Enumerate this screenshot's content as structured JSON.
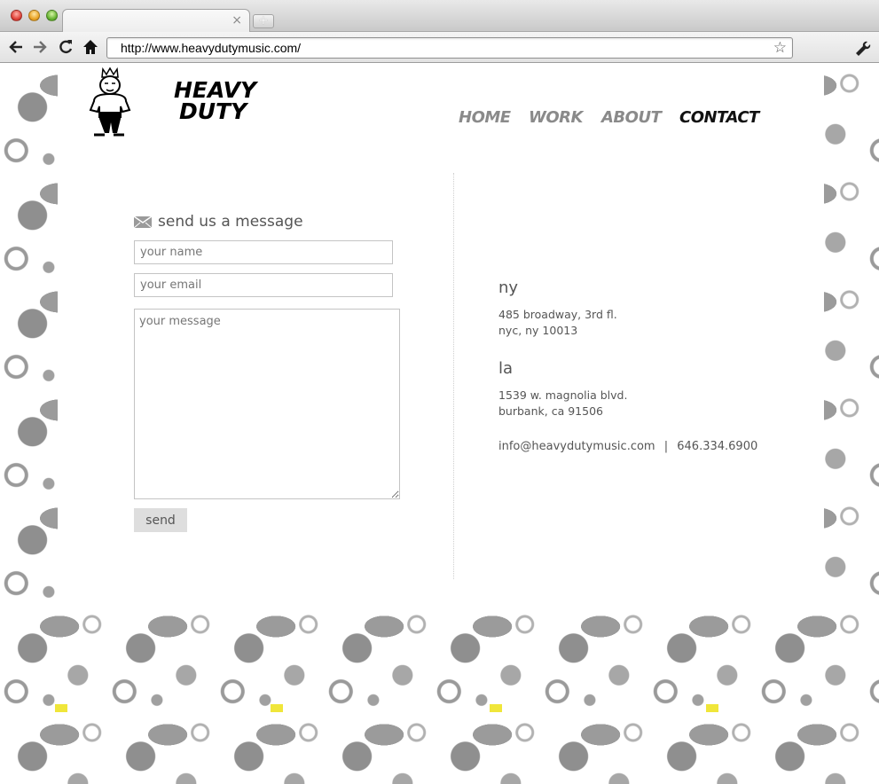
{
  "browser": {
    "url": "http://www.heavydutymusic.com/",
    "new_tab_symbol": "+",
    "tab_close_symbol": "×"
  },
  "site": {
    "logo_line1": "HEAVY",
    "logo_line2": "DUTY",
    "nav": [
      {
        "label": "HOME",
        "active": false
      },
      {
        "label": "WORK",
        "active": false
      },
      {
        "label": "ABOUT",
        "active": false
      },
      {
        "label": "CONTACT",
        "active": true
      }
    ]
  },
  "form": {
    "title": "send us a message",
    "name_placeholder": "your name",
    "email_placeholder": "your email",
    "message_placeholder": "your message",
    "send_label": "send"
  },
  "offices": {
    "ny": {
      "name": "ny",
      "line1": "485 broadway, 3rd fl.",
      "line2": "nyc, ny 10013"
    },
    "la": {
      "name": "la",
      "line1": "1539 w. magnolia blvd.",
      "line2": "burbank, ca 91506"
    }
  },
  "contact": {
    "email": "info@heavydutymusic.com",
    "separator": "|",
    "phone": "646.334.6900"
  },
  "colors": {
    "nav_inactive": "#8a8a8a",
    "nav_active": "#111111",
    "text": "#555555",
    "pattern": "#9a9a9a",
    "crown": "#f0e63a"
  },
  "icons": [
    "back-arrow-icon",
    "forward-arrow-icon",
    "reload-icon",
    "home-icon",
    "bookmark-star-icon",
    "wrench-icon",
    "envelope-icon"
  ]
}
